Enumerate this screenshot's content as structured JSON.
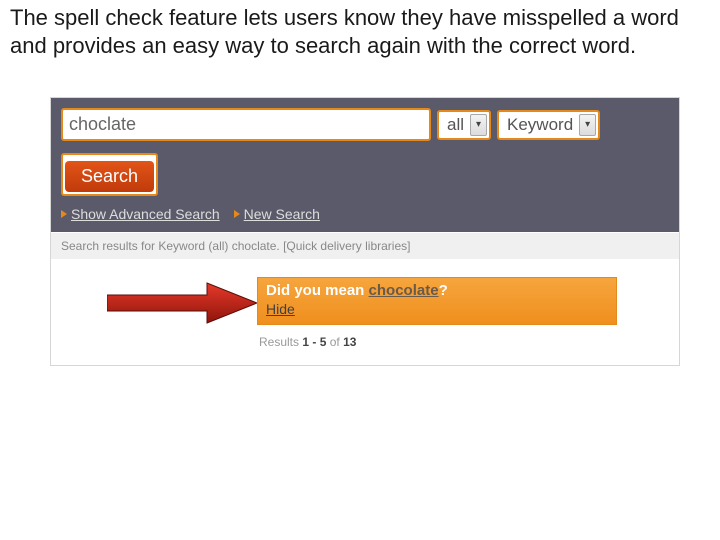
{
  "intro": "The spell check feature lets users know they have misspelled a word and provides an easy way to search again with the correct word.",
  "search": {
    "query": "choclate",
    "scope": "all",
    "field": "Keyword",
    "button": "Search",
    "advanced": "Show Advanced Search",
    "newsearch": "New Search"
  },
  "results_for": "Search results for Keyword (all) choclate. [Quick delivery libraries]",
  "dym": {
    "prefix": "Did you mean ",
    "suggestion": "chocolate",
    "suffix": "?",
    "hide": "Hide"
  },
  "count": {
    "prefix": "Results ",
    "range": "1 - 5",
    "of": " of ",
    "total": "13"
  }
}
